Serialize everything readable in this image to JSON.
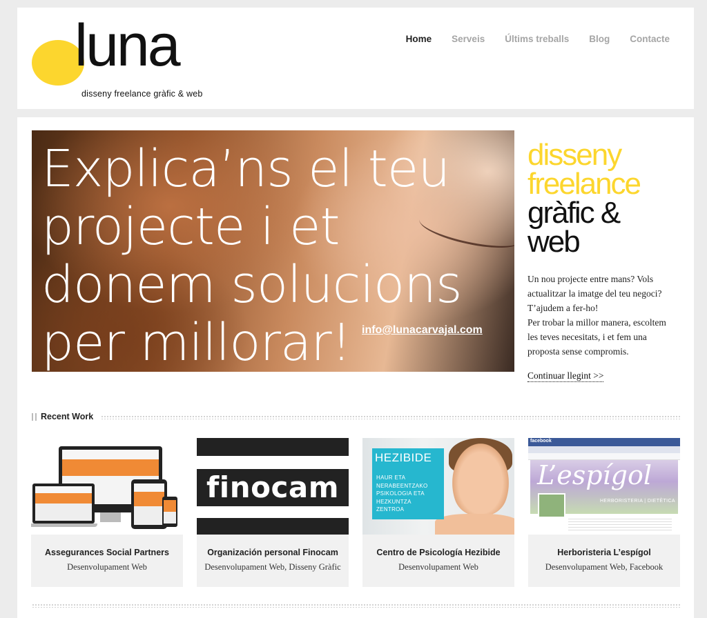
{
  "brand": {
    "logo_word": "luna",
    "tagline": "disseny freelance gràfic & web",
    "accent": "#fcd62e"
  },
  "nav": {
    "items": [
      {
        "label": "Home",
        "active": true
      },
      {
        "label": "Serveis",
        "active": false
      },
      {
        "label": "Últims treballs",
        "active": false
      },
      {
        "label": "Blog",
        "active": false
      },
      {
        "label": "Contacte",
        "active": false
      }
    ]
  },
  "hero": {
    "lines": [
      "Explica’ns el teu",
      "projecte i et",
      "donem solucions",
      "per millorar!"
    ],
    "email": "info@lunacarvajal.com"
  },
  "side": {
    "title_yellow_1": "disseny",
    "title_yellow_2": "freelance",
    "title_black_1": "gràfic &",
    "title_black_2": "web",
    "body_lines": [
      "Un nou projecte entre mans? Vols",
      "actualitzar la imatge del teu negoci?",
      "T’ajudem a fer-ho!",
      "Per trobar la millor manera, escoltem",
      "les teves necesitats, i et fem una",
      "proposta sense compromis."
    ],
    "more_link": "Continuar llegint >>"
  },
  "recent": {
    "title": "Recent Work",
    "cards": [
      {
        "title": "Assegurances Social Partners",
        "subtitle": "Desenvolupament Web"
      },
      {
        "title": "Organización personal Finocam",
        "subtitle": "Desenvolupament Web, Disseny Gràfic",
        "image_text": "finocam"
      },
      {
        "title": "Centro de Psicología Hezibide",
        "subtitle": "Desenvolupament Web",
        "image_title": "HEZIBIDE",
        "image_lines": [
          "HAUR ETA",
          "NERABEENTZAKO",
          "PSIKOLOGIA ETA",
          "HEZKUNTZA",
          "ZENTROA"
        ]
      },
      {
        "title": "Herboristeria L’espígol",
        "subtitle": "Desenvolupament Web, Facebook",
        "image_title": "L’espígol",
        "image_sub": "HERBORISTERIA | DIETÈTICA",
        "fb_label": "facebook"
      }
    ]
  }
}
